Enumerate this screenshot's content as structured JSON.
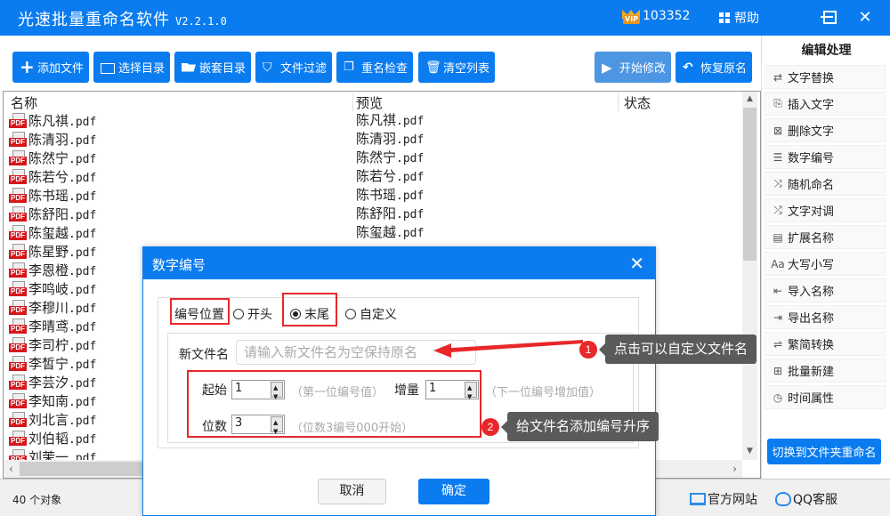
{
  "app": {
    "title": "光速批量重命名软件",
    "version": "V2.2.1.0",
    "vip_id": "103352",
    "vip_label": "VIP",
    "help_label": "帮助"
  },
  "toolbar": {
    "buttons": [
      {
        "label": "添加文件",
        "icon": "plus-icon"
      },
      {
        "label": "选择目录",
        "icon": "folder-add-icon"
      },
      {
        "label": "嵌套目录",
        "icon": "folder-open-icon"
      },
      {
        "label": "文件过滤",
        "icon": "filter-icon"
      },
      {
        "label": "重名检查",
        "icon": "duplicate-icon"
      },
      {
        "label": "清空列表",
        "icon": "trash-icon"
      }
    ],
    "start_label": "开始修改",
    "restore_label": "恢复原名"
  },
  "file_list": {
    "columns": [
      "名称",
      "预览",
      "状态"
    ],
    "rows": [
      {
        "name": "陈凡祺.pdf",
        "preview": "陈凡祺.pdf"
      },
      {
        "name": "陈清羽.pdf",
        "preview": "陈清羽.pdf"
      },
      {
        "name": "陈然宁.pdf",
        "preview": "陈然宁.pdf"
      },
      {
        "name": "陈若兮.pdf",
        "preview": "陈若兮.pdf"
      },
      {
        "name": "陈书瑶.pdf",
        "preview": "陈书瑶.pdf"
      },
      {
        "name": "陈舒阳.pdf",
        "preview": "陈舒阳.pdf"
      },
      {
        "name": "陈玺越.pdf",
        "preview": "陈玺越.pdf"
      },
      {
        "name": "陈星野.pdf",
        "preview": ""
      },
      {
        "name": "李恩橙.pdf",
        "preview": ""
      },
      {
        "name": "李鸣岐.pdf",
        "preview": ""
      },
      {
        "name": "李穆川.pdf",
        "preview": ""
      },
      {
        "name": "李晴鸢.pdf",
        "preview": ""
      },
      {
        "name": "李司柠.pdf",
        "preview": ""
      },
      {
        "name": "李皙宁.pdf",
        "preview": ""
      },
      {
        "name": "李芸汐.pdf",
        "preview": ""
      },
      {
        "name": "李知南.pdf",
        "preview": ""
      },
      {
        "name": "刘北言.pdf",
        "preview": ""
      },
      {
        "name": "刘伯韬.pdf",
        "preview": ""
      },
      {
        "name": "刘茉一.pdf",
        "preview": ""
      }
    ],
    "object_count": "40 个对象"
  },
  "sidebar": {
    "header": "编辑处理",
    "items": [
      {
        "label": "文字替换",
        "icon": "replace-icon",
        "glyph": "⇄"
      },
      {
        "label": "插入文字",
        "icon": "insert-text-icon",
        "glyph": "⎘"
      },
      {
        "label": "删除文字",
        "icon": "delete-text-icon",
        "glyph": "⊠"
      },
      {
        "label": "数字编号",
        "icon": "numbering-icon",
        "glyph": "☰"
      },
      {
        "label": "随机命名",
        "icon": "shuffle-icon",
        "glyph": "⤨"
      },
      {
        "label": "文字对调",
        "icon": "swap-icon",
        "glyph": "⤮"
      },
      {
        "label": "扩展名称",
        "icon": "extension-icon",
        "glyph": "▤"
      },
      {
        "label": "大写小写",
        "icon": "case-icon",
        "glyph": "Aa"
      },
      {
        "label": "导入名称",
        "icon": "import-icon",
        "glyph": "⇤"
      },
      {
        "label": "导出名称",
        "icon": "export-icon",
        "glyph": "⇥"
      },
      {
        "label": "繁简转换",
        "icon": "convert-icon",
        "glyph": "⇌"
      },
      {
        "label": "批量新建",
        "icon": "new-file-icon",
        "glyph": "⊞"
      },
      {
        "label": "时间属性",
        "icon": "clock-icon",
        "glyph": "◷"
      }
    ],
    "switch_label": "切换到文件夹重命名"
  },
  "footer": {
    "website_label": "官方网站",
    "qq_label": "QQ客服"
  },
  "dialog": {
    "title": "数字编号",
    "position_label": "编号位置",
    "position_options": [
      "开头",
      "末尾",
      "自定义"
    ],
    "position_selected": "末尾",
    "new_name_label": "新文件名",
    "new_name_placeholder": "请输入新文件名为空保持原名",
    "new_name_value": "",
    "start_label": "起始",
    "start_value": "1",
    "start_hint": "（第一位编号值）",
    "increment_label": "增量",
    "increment_value": "1",
    "increment_hint": "（下一位编号增加值）",
    "digits_label": "位数",
    "digits_value": "3",
    "digits_hint": "（位数3编号000开始）",
    "cancel_label": "取消",
    "ok_label": "确定"
  },
  "annotations": [
    {
      "number": "1",
      "text": "点击可以自定义文件名"
    },
    {
      "number": "2",
      "text": "给文件名添加编号升序"
    }
  ],
  "colors": {
    "accent": "#0a7cf0",
    "annotation_red": "#e8272a",
    "tooltip_bg": "#5a5a5a"
  }
}
